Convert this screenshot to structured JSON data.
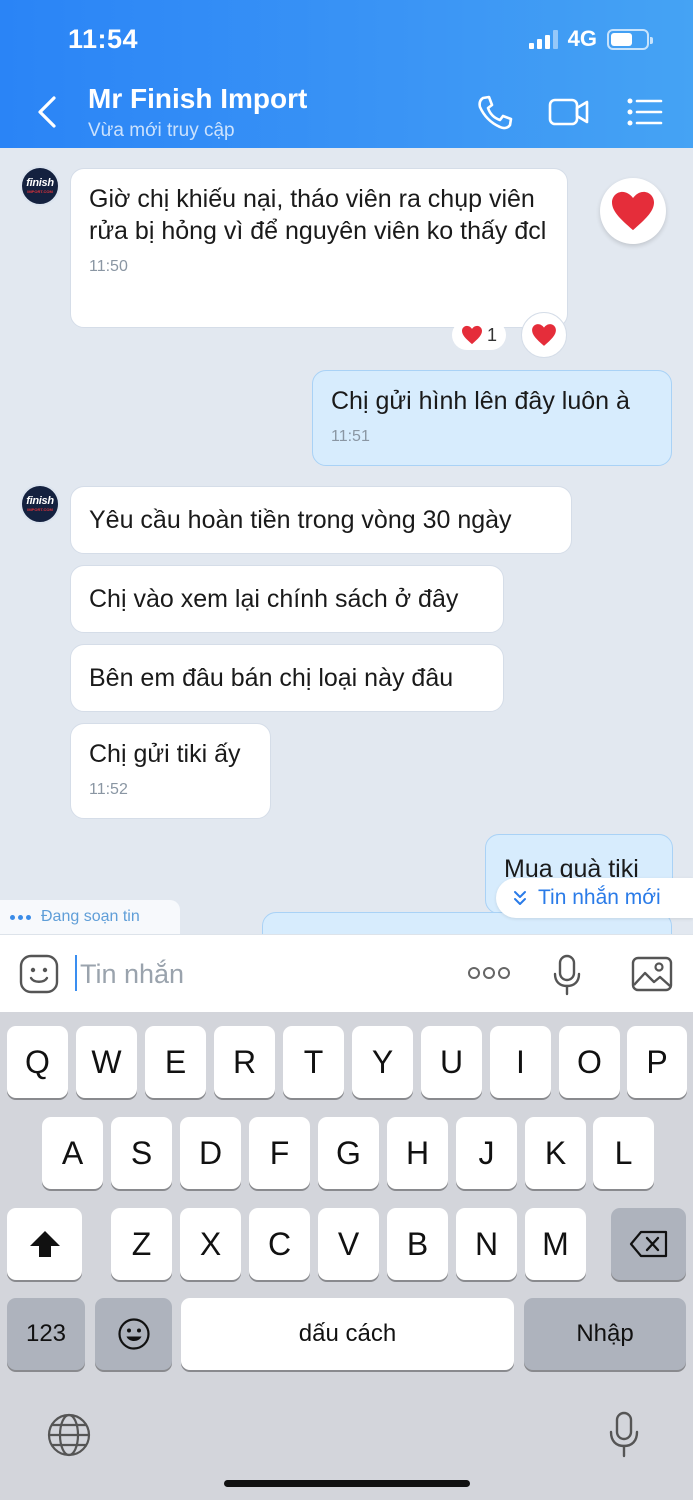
{
  "status": {
    "time": "11:54",
    "network": "4G"
  },
  "header": {
    "title": "Mr Finish Import",
    "subtitle": "Vừa mới truy cập"
  },
  "avatar": {
    "line1": "finish",
    "line2": "IMPORT.COM"
  },
  "messages": [
    {
      "side": "in",
      "text": "Giờ chị khiếu nại, tháo viên ra chụp viên rửa bị hỏng vì để nguyên viên ko thấy đcl",
      "time": "11:50"
    },
    {
      "side": "out",
      "text": "Chị gửi hình lên đây luôn à",
      "time": "11:51"
    },
    {
      "side": "in",
      "text": "Yêu cầu hoàn tiền trong vòng 30 ngày"
    },
    {
      "side": "in",
      "text": "Chị vào xem lại chính sách ở đây"
    },
    {
      "side": "in",
      "text": "Bên em đâu bán chị loại này đâu"
    },
    {
      "side": "in",
      "text": "Chị gửi tiki ấy",
      "time": "11:52"
    },
    {
      "side": "out",
      "text": "Mua quà tiki"
    }
  ],
  "reaction": {
    "count": "1"
  },
  "typing_label": "Đang soạn tin",
  "new_message_label": "Tin nhắn mới",
  "input": {
    "placeholder": "Tin nhắn"
  },
  "keyboard": {
    "row1": [
      "Q",
      "W",
      "E",
      "R",
      "T",
      "Y",
      "U",
      "I",
      "O",
      "P"
    ],
    "row2": [
      "A",
      "S",
      "D",
      "F",
      "G",
      "H",
      "J",
      "K",
      "L"
    ],
    "row3": [
      "Z",
      "X",
      "C",
      "V",
      "B",
      "N",
      "M"
    ],
    "numbers_label": "123",
    "space_label": "dấu cách",
    "return_label": "Nhập"
  },
  "colors": {
    "header_blue": "#2a84f6",
    "out_bubble": "#d7ecfd",
    "heart": "#e52d3a",
    "link_blue": "#2a7be8"
  }
}
